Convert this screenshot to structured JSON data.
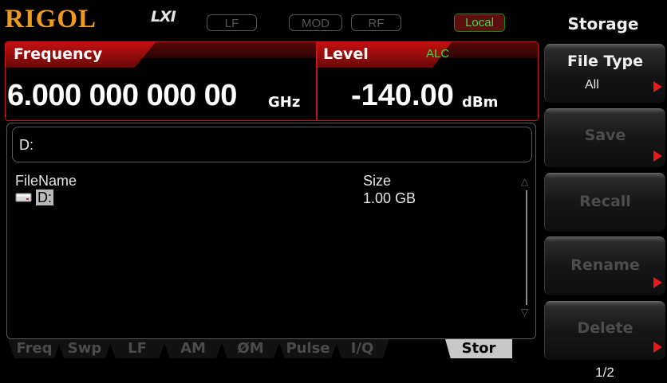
{
  "status_bar": {
    "brand": "RIGOL",
    "lxi": "LXI",
    "indicators": {
      "lf": "LF",
      "mod": "MOD",
      "rf": "RF"
    },
    "remote_state": "Local"
  },
  "readout": {
    "frequency_label": "Frequency",
    "frequency_value": "6.000 000 000 00",
    "frequency_unit": "GHz",
    "level_label": "Level",
    "alc_label": "ALC",
    "level_value": "-140.00",
    "level_unit": "dBm"
  },
  "browser": {
    "path": "D:",
    "columns": {
      "name": "FileName",
      "size": "Size"
    },
    "rows": [
      {
        "icon": "drive-icon",
        "name": "D:",
        "size": "1.00 GB"
      }
    ]
  },
  "tabs": [
    "Freq",
    "Swp",
    "LF",
    "AM",
    "ØM",
    "Pulse",
    "I/Q",
    "Stor"
  ],
  "active_tab": "Stor",
  "menu": {
    "title": "Storage",
    "items": [
      {
        "label": "File Type",
        "value": "All",
        "enabled": true
      },
      {
        "label": "Save",
        "enabled": false
      },
      {
        "label": "Recall",
        "enabled": false
      },
      {
        "label": "Rename",
        "enabled": false
      },
      {
        "label": "Delete",
        "enabled": false
      }
    ],
    "page": "1/2"
  },
  "colors": {
    "brand": "#f09a1c",
    "accent_red": "#c01818",
    "alc_green": "#29e03a",
    "local_green": "#31e04a",
    "arrow_red": "#e21b1b"
  }
}
